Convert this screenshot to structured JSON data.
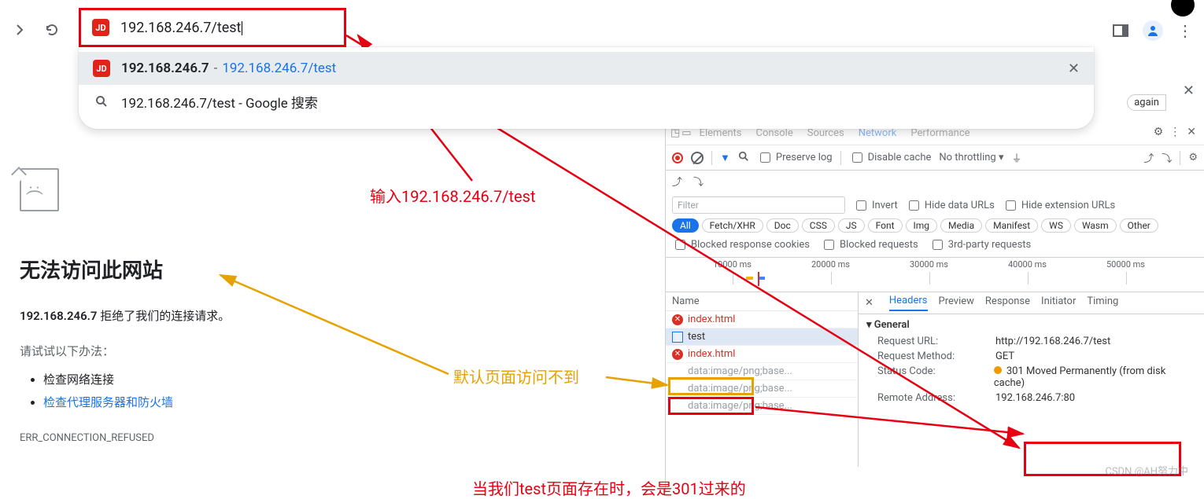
{
  "browser": {
    "omnibox_text": "192.168.246.7/test",
    "favicon": "JD",
    "suggestions": [
      {
        "icon": "JD",
        "bold": "192.168.246.7",
        "sep": " - ",
        "url": "192.168.246.7/test",
        "selected": true,
        "closable": true
      },
      {
        "icon": "search",
        "text": "192.168.246.7/test - Google 搜索"
      }
    ],
    "again_chip": "again"
  },
  "error_page": {
    "title": "无法访问此网站",
    "host": "192.168.246.7",
    "refused": " 拒绝了我们的连接请求。",
    "try_label": "请试试以下办法：",
    "bullets": [
      "检查网络连接",
      "检查代理服务器和防火墙"
    ],
    "code": "ERR_CONNECTION_REFUSED"
  },
  "annotations": {
    "input_text": "输入192.168.246.7/test",
    "default_page_fail": "默认页面访问不到",
    "test_301": "当我们test页面存在时，会是301过来的"
  },
  "devtools": {
    "tabs": [
      "Elements",
      "Console",
      "Sources",
      "Network",
      "Performance"
    ],
    "active_tab": "Network",
    "toolbar": {
      "preserve_log": "Preserve log",
      "disable_cache": "Disable cache",
      "throttling": "No throttling"
    },
    "filter": {
      "placeholder": "Filter",
      "invert": "Invert",
      "hide_data_urls": "Hide data URLs",
      "hide_ext_urls": "Hide extension URLs",
      "types": [
        "All",
        "Fetch/XHR",
        "Doc",
        "CSS",
        "JS",
        "Font",
        "Img",
        "Media",
        "Manifest",
        "WS",
        "Wasm",
        "Other"
      ],
      "blocked_cookies": "Blocked response cookies",
      "blocked_requests": "Blocked requests",
      "third_party": "3rd-party requests"
    },
    "timeline": [
      "10000 ms",
      "20000 ms",
      "30000 ms",
      "40000 ms",
      "50000 ms"
    ],
    "name_header": "Name",
    "requests": [
      {
        "icon": "red",
        "name": "index.html",
        "cls": "reqred"
      },
      {
        "icon": "doc",
        "name": "test",
        "cls": "",
        "sel": true
      },
      {
        "icon": "red",
        "name": "index.html",
        "cls": "reqred"
      },
      {
        "icon": "",
        "name": "data:image/png;base...",
        "cls": "reqdim"
      },
      {
        "icon": "",
        "name": "data:image/png;base...",
        "cls": "reqdim"
      },
      {
        "icon": "",
        "name": "data:image/png;base...",
        "cls": "reqdim"
      }
    ],
    "detail_tabs": [
      "Headers",
      "Preview",
      "Response",
      "Initiator",
      "Timing"
    ],
    "general_label": "General",
    "headers": {
      "Request URL:": "http://192.168.246.7/test",
      "Request Method:": "GET",
      "Status Code:": "301 Moved Permanently (from disk cache)",
      "Remote Address:": "192.168.246.7:80"
    }
  },
  "watermark": "CSDN @AH努力中"
}
